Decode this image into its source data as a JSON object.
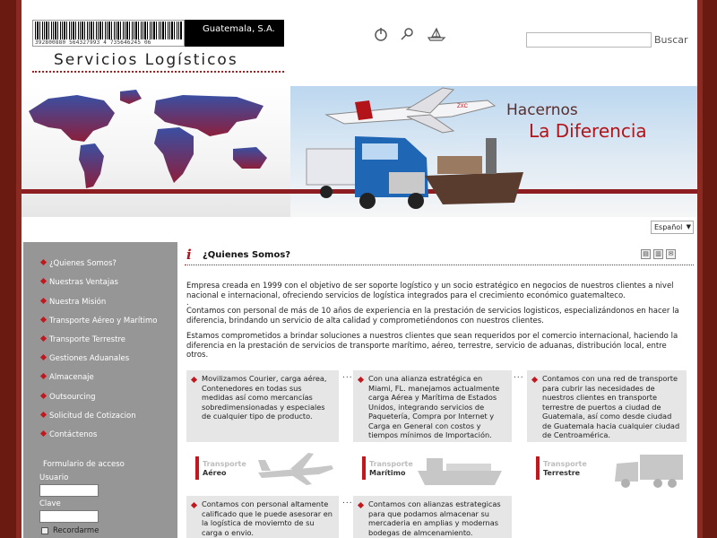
{
  "header": {
    "barcode_number": "392800880 564327993 4 735646245 06",
    "company": "Guatemala, S.A.",
    "brand": "Servicios Logísticos",
    "search": {
      "placeholder": "",
      "button": "Buscar"
    },
    "icons": [
      "power-icon",
      "search-icon",
      "ship-icon"
    ]
  },
  "banner": {
    "slogan_line1": "Hacernos",
    "slogan_line2": "La Diferencia",
    "plane_label": "ZXC"
  },
  "language": {
    "selected": "Español"
  },
  "sidebar": {
    "items": [
      {
        "label": "¿Quienes Somos?"
      },
      {
        "label": "Nuestras Ventajas"
      },
      {
        "label": "Nuestra Misión"
      },
      {
        "label": "Transporte Aéreo y Marítimo"
      },
      {
        "label": "Transporte Terrestre"
      },
      {
        "label": "Gestiones Aduanales"
      },
      {
        "label": "Almacenaje"
      },
      {
        "label": "Outsourcing"
      },
      {
        "label": "Solicitud de Cotizacion"
      },
      {
        "label": "Contáctenos"
      }
    ],
    "login": {
      "title": "Formulario de acceso",
      "user_label": "Usuario",
      "password_label": "Clave",
      "remember_label": "Recordarme"
    }
  },
  "content": {
    "title": "¿Quienes Somos?",
    "paragraphs": [
      "Empresa creada en 1999 con el objetivo de ser soporte logístico y un socio estratégico en negocios de nuestros clientes a nivel nacional e internacional, ofreciendo servicios de logística integrados para el crecimiento económico guatemalteco.",
      ".",
      "Contamos con personal de más de 10 años de experiencia en la prestación de servicios logisticos, especializándonos en hacer la diferencia, brindando un servicio de alta calidad y comprometiéndonos con nuestros clientes.",
      "Estamos comprometidos a brindar soluciones a nuestros clientes que sean requeridos por el comercio internacional, haciendo la diferencia en la prestación de servicios de transporte marítimo, aéreo, terrestre, servicio de aduanas, distribución local, entre otros."
    ],
    "boxes_row1": [
      "Movilizamos Courier, carga aérea, Contenedores en todas sus medidas así como mercancías sobredimensionadas y especiales de cualquier tipo de producto.",
      "Con una alianza estratégica en Miami, FL. manejamos actualmente carga Aérea y Marítima de Estados Unidos, integrando servicios de Paquetería, Compra por Internet y Carga en General con costos y tiempos mínimos de Importación.",
      "Contamos con una red de transporte para cubrir las necesidades de nuestros clientes en transporte terrestre de puertos a ciudad de Guatemala, así como desde ciudad de Guatemala hacia cualquier ciudad de Centroamérica."
    ],
    "separator": "...",
    "transports": [
      {
        "line1": "Transporte",
        "line2": "Aéreo"
      },
      {
        "line1": "Transporte",
        "line2": "Marítimo"
      },
      {
        "line1": "Transporte",
        "line2": "Terrestre"
      }
    ],
    "boxes_row2": [
      "Contamos con personal altamente calificado que le puede asesorar en la logística de moviemto de su carga o envio.",
      "Contamos con alianzas estrategicas para que podamos almacenar su mercaderia en amplias y modernas bodegas de almcenamiento."
    ]
  },
  "colors": {
    "accent": "#b3141a",
    "frame": "#6b1a12",
    "sidebar": "#969696",
    "box": "#e6e6e6"
  }
}
